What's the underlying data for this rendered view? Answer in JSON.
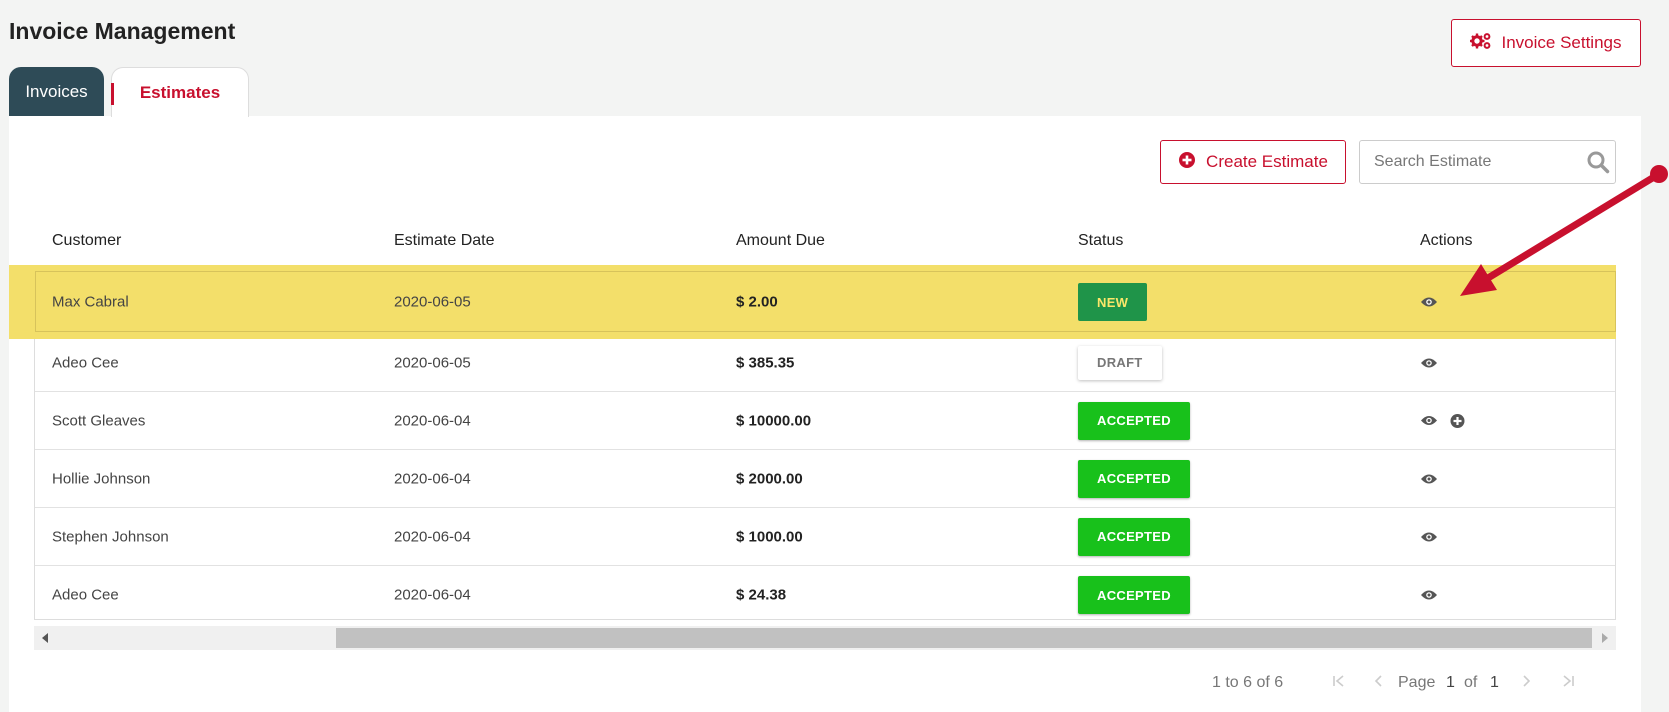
{
  "header": {
    "title": "Invoice Management",
    "settings_label": "Invoice Settings"
  },
  "tabs": [
    {
      "label": "Invoices",
      "active": false
    },
    {
      "label": "Estimates",
      "active": true
    }
  ],
  "toolbar": {
    "create_label": "Create Estimate",
    "search_placeholder": "Search Estimate"
  },
  "table": {
    "columns": [
      "Customer",
      "Estimate Date",
      "Amount Due",
      "Status",
      "Actions"
    ],
    "rows": [
      {
        "customer": "Max Cabral",
        "date": "2020-06-05",
        "amount": "$ 2.00",
        "status": "NEW",
        "actions": [
          "view"
        ]
      },
      {
        "customer": "Adeo Cee",
        "date": "2020-06-05",
        "amount": "$ 385.35",
        "status": "DRAFT",
        "actions": [
          "view"
        ]
      },
      {
        "customer": "Scott Gleaves",
        "date": "2020-06-04",
        "amount": "$ 10000.00",
        "status": "ACCEPTED",
        "actions": [
          "view",
          "add"
        ]
      },
      {
        "customer": "Hollie Johnson",
        "date": "2020-06-04",
        "amount": "$ 2000.00",
        "status": "ACCEPTED",
        "actions": [
          "view"
        ]
      },
      {
        "customer": "Stephen Johnson",
        "date": "2020-06-04",
        "amount": "$ 1000.00",
        "status": "ACCEPTED",
        "actions": [
          "view"
        ]
      },
      {
        "customer": "Adeo Cee",
        "date": "2020-06-04",
        "amount": "$ 24.38",
        "status": "ACCEPTED",
        "actions": [
          "view"
        ]
      }
    ]
  },
  "pagination": {
    "summary": "1 to 6 of 6",
    "page_label": "Page",
    "current": "1",
    "of_label": "of",
    "total": "1"
  },
  "colors": {
    "brand_red": "#c8102e",
    "tab_dark": "#2e4b57",
    "highlight": "#f3df6a",
    "status_new": "#1f9449",
    "status_accepted": "#18c11b"
  }
}
